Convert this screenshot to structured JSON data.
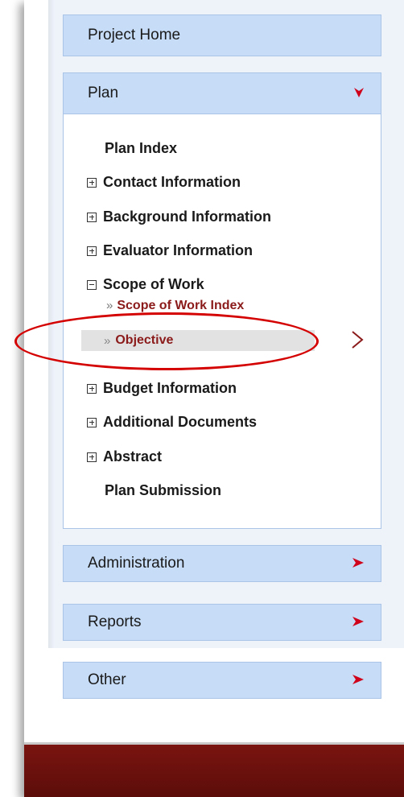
{
  "nav": {
    "project_home": "Project Home",
    "plan": {
      "label": "Plan",
      "items": [
        "Plan Index",
        "Contact Information",
        "Background Information",
        "Evaluator Information",
        "Scope of Work",
        "Budget Information",
        "Additional Documents",
        "Abstract",
        "Plan Submission"
      ],
      "scope_sub": {
        "index": "Scope of Work Index",
        "objective": "Objective"
      }
    },
    "administration": "Administration",
    "reports": "Reports",
    "other": "Other"
  },
  "colors": {
    "header_bg": "#c6dcf7",
    "arrow": "#d0021b",
    "link_dark_red": "#8b1a1a",
    "highlight": "#d40000",
    "footer": "#6a110d"
  },
  "icons": {
    "expand": "plus-box-icon",
    "collapse": "minus-box-icon",
    "down_arrow": "down-arrow-icon",
    "right_arrow": "right-arrow-icon",
    "chevron": "double-chevron-icon"
  }
}
